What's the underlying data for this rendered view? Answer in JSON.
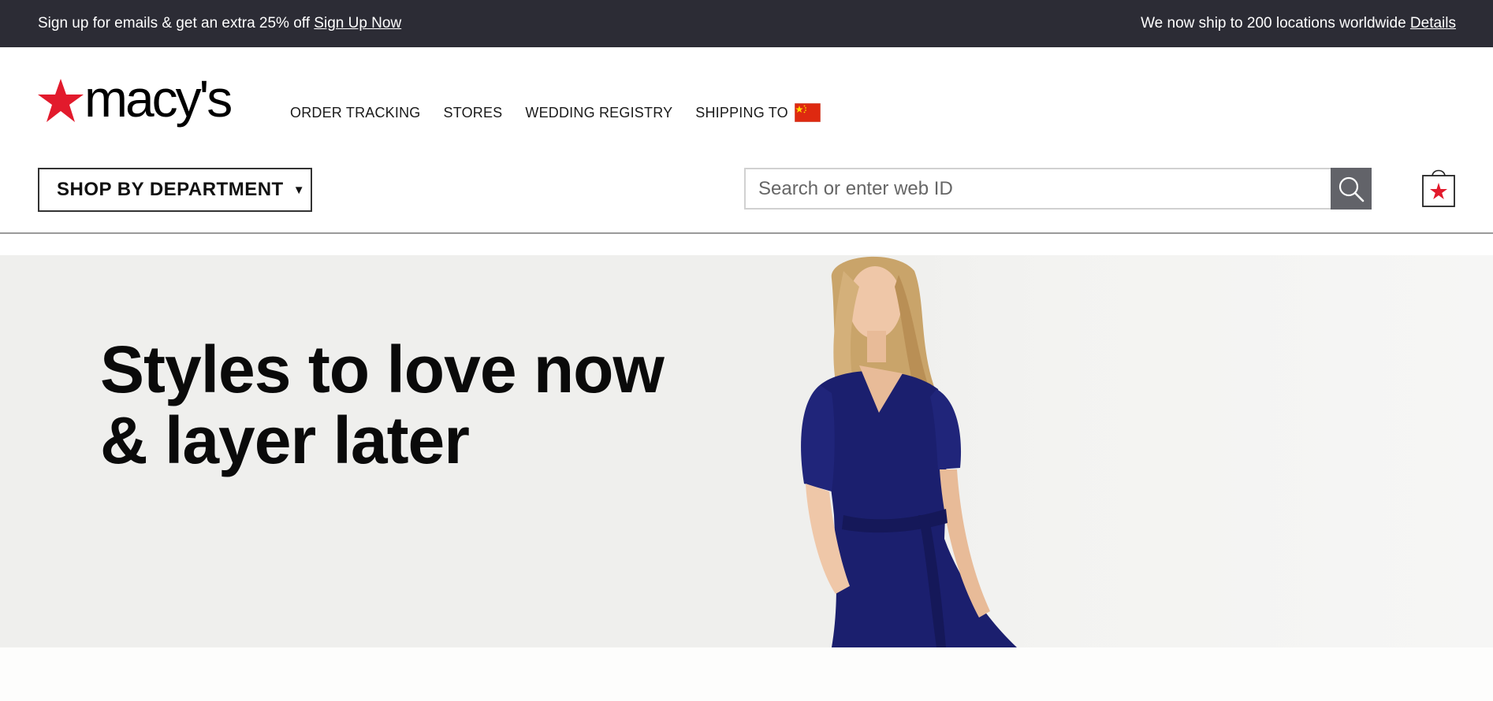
{
  "promo": {
    "left_text": "Sign up for emails & get an extra 25% off",
    "left_link": "Sign Up Now",
    "right_text": "We now ship to 200 locations worldwide",
    "right_link": "Details"
  },
  "brand": {
    "name": "macy's",
    "star_color": "#e21a2c"
  },
  "nav": {
    "items": [
      "ORDER TRACKING",
      "STORES",
      "WEDDING REGISTRY"
    ],
    "shipping_label": "SHIPPING TO",
    "flag": "china-flag-icon"
  },
  "department": {
    "label": "SHOP BY DEPARTMENT"
  },
  "search": {
    "placeholder": "Search or enter web ID",
    "icon": "search-icon"
  },
  "bag": {
    "icon": "shopping-bag-icon"
  },
  "hero": {
    "line1": "Styles to love now",
    "line2": "& layer later",
    "dress_color": "#1b1f6e"
  },
  "colors": {
    "promo_bg": "#2c2c35",
    "search_button": "#626369",
    "brand_red": "#e21a2c"
  }
}
